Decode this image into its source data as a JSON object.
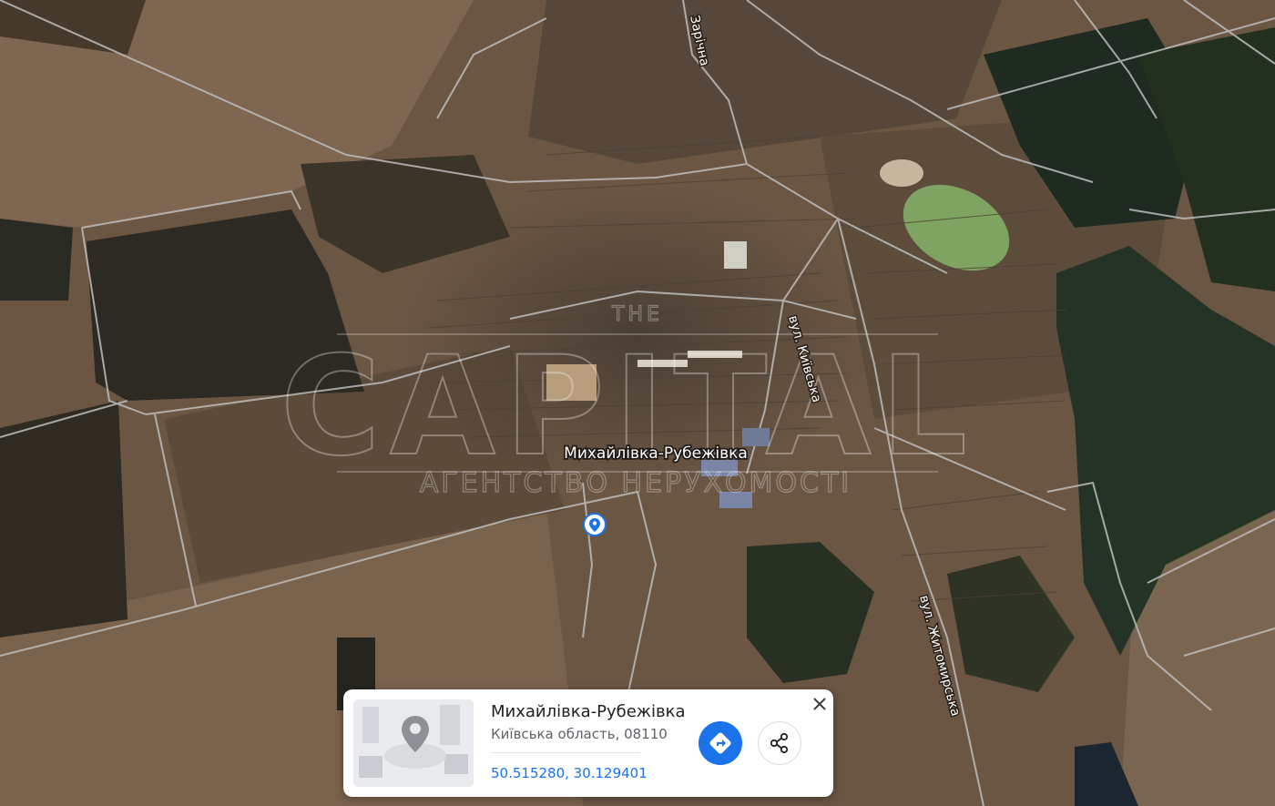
{
  "map": {
    "type": "satellite",
    "place_label": "Михайлівка-Рубежівка",
    "streets": [
      {
        "id": "zarichna",
        "label": "Зарічна"
      },
      {
        "id": "kyivska",
        "label": "вул. Київська"
      },
      {
        "id": "zhytomyrska",
        "label": "вул. Житомирська"
      }
    ],
    "marker_icon": "location-pin-icon"
  },
  "watermark": {
    "the": "THE",
    "title": "CAPITAL",
    "subtitle": "АГЕНТСТВО НЕРУХОМОСТІ"
  },
  "card": {
    "title": "Михайлівка-Рубежівка",
    "address": "Київська область, 08110",
    "coordinates": "50.515280, 30.129401",
    "directions_icon": "directions-icon",
    "share_icon": "share-icon",
    "close_icon": "close-icon",
    "thumbnail_icon": "location-pin-icon"
  },
  "colors": {
    "accent": "#1a73e8",
    "field": "#6b5644",
    "forest": "#243325",
    "lake": "#7fa461"
  }
}
